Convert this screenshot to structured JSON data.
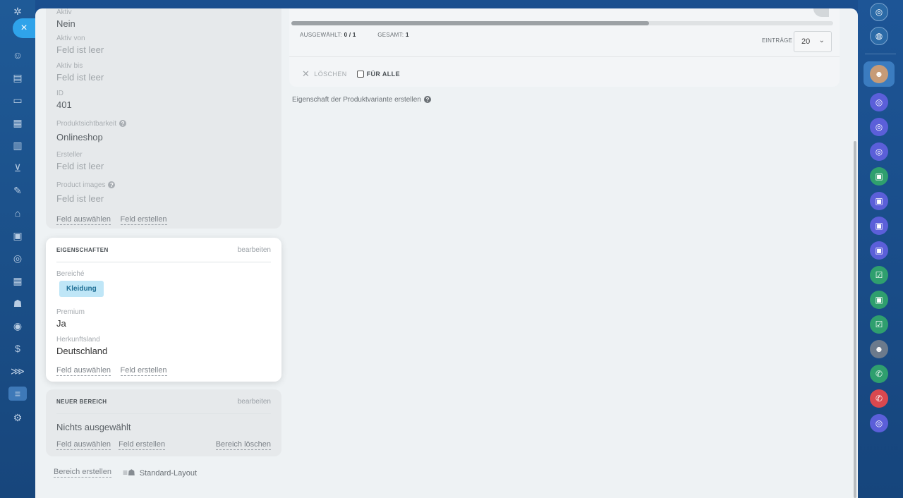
{
  "details": {
    "fields": [
      {
        "label": "Aktiv",
        "value": "Nein",
        "empty": false
      },
      {
        "label": "Aktiv von",
        "value": "Feld ist leer",
        "empty": true
      },
      {
        "label": "Aktiv bis",
        "value": "Feld ist leer",
        "empty": true
      },
      {
        "label": "ID",
        "value": "401",
        "empty": false
      },
      {
        "label": "Produktsichtbarkeit",
        "value": "Onlineshop",
        "empty": false,
        "help": true
      },
      {
        "label": "Ersteller",
        "value": "Feld ist leer",
        "empty": true
      },
      {
        "label": "Product images",
        "value": "Feld ist leer",
        "empty": true,
        "help": true
      }
    ],
    "select_field": "Feld auswählen",
    "create_field": "Feld erstellen"
  },
  "properties": {
    "title": "EIGENSCHAFTEN",
    "edit": "bearbeiten",
    "sections_label": "Bereiché",
    "tag": "Kleidung",
    "premium_label": "Premium",
    "premium_value": "Ja",
    "origin_label": "Herkunftsland",
    "origin_value": "Deutschland",
    "select_field": "Feld auswählen",
    "create_field": "Feld erstellen"
  },
  "new_section": {
    "title": "NEUER BEREICH",
    "edit": "bearbeiten",
    "value": "Nichts ausgewählt",
    "select_field": "Feld auswählen",
    "create_field": "Feld erstellen",
    "delete_section": "Bereich löschen"
  },
  "bottom": {
    "create_section": "Bereich erstellen",
    "default_layout": "Standard-Layout"
  },
  "grid": {
    "selected_label": "AUSGEWÄHLT:",
    "selected_value": "0 / 1",
    "total_label": "GESAMT:",
    "total_value": "1",
    "entries_label": "EINTRÄGE",
    "entries_value": "20",
    "delete": "LÖSCHEN",
    "for_all": "FÜR ALLE",
    "scroll_fraction": 0.66
  },
  "create_variant_property": "Eigenschaft der Produktvariante erstellen",
  "close_label": "×"
}
